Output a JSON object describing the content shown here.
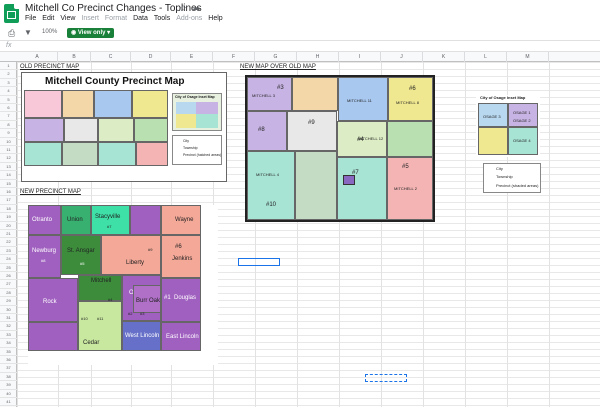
{
  "app": {
    "title": "Mitchell Co Precinct Changes - Toplines"
  },
  "menu": [
    "File",
    "Edit",
    "View",
    "Insert",
    "Format",
    "Data",
    "Tools",
    "Add-ons",
    "Help"
  ],
  "menu_disabled": [
    "Insert",
    "Format",
    "Add-ons"
  ],
  "toolbar": {
    "zoom": "100%",
    "mode": "View only"
  },
  "formula": {
    "fx": "fx"
  },
  "columns": [
    "A",
    "B",
    "C",
    "D",
    "E",
    "F",
    "G",
    "H",
    "I",
    "J",
    "K",
    "L",
    "M"
  ],
  "rows": [
    "1",
    "2",
    "3",
    "4",
    "5",
    "6",
    "7",
    "8",
    "9",
    "10",
    "11",
    "12",
    "13",
    "14",
    "15",
    "16",
    "17",
    "18",
    "19",
    "20",
    "21",
    "22",
    "23",
    "24",
    "25",
    "26",
    "27",
    "28",
    "29",
    "30",
    "31",
    "32",
    "33",
    "34",
    "35",
    "36",
    "37",
    "38",
    "39",
    "40",
    "41"
  ],
  "labels": {
    "old": "OLD PRECINCT MAP",
    "newmap": "NEW PRECINCT MAP",
    "over": "NEW MAP OVER OLD MAP"
  },
  "oldmap": {
    "title": "Mitchell County Precinct Map",
    "inset": "City of Osage Inset Map",
    "legend": [
      "City",
      "Township",
      "Precinct (hatched areas)"
    ]
  },
  "overmap": {
    "inset": "City of Osage Inset Map",
    "legend": [
      "City",
      "Township",
      "Precinct (shaded areas)"
    ],
    "regions": [
      "MITCHELL 3",
      "MITCHELL 11",
      "MITCHELL 8",
      "MITCHELL 4",
      "MITCHELL 12",
      "MITCHELL 2",
      "OSAGE 3",
      "OSAGE 1",
      "OSAGE 2",
      "OSAGE 4"
    ],
    "notes": [
      "#3",
      "#6",
      "#9",
      "#8",
      "#5",
      "#10",
      "#7",
      "#4"
    ]
  },
  "newmap": {
    "precincts": [
      "Otranto",
      "Union",
      "Stacyville",
      "Wayne",
      "Newburg",
      "St. Ansgar",
      "Liberty",
      "Jenkins",
      "Mitchell",
      "Rock",
      "Osage",
      "Burr Oak",
      "Douglas",
      "Cedar",
      "West Lincoln",
      "East Lincoln"
    ],
    "nums": [
      "#7",
      "#6",
      "#8",
      "#9",
      "#5",
      "#4",
      "#10",
      "#11",
      "#12",
      "#1",
      "#2",
      "#3"
    ]
  }
}
